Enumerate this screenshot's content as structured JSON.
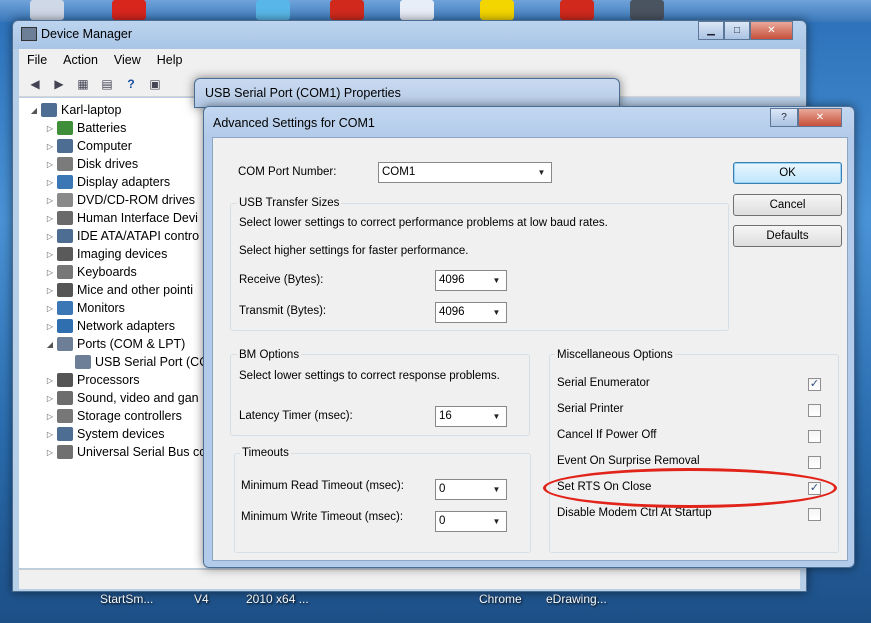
{
  "taskbar": {
    "labels": [
      "StartSm...",
      "V4",
      "2010 x64 ...",
      "Chrome",
      "eDrawing..."
    ]
  },
  "device_manager": {
    "title": "Device Manager",
    "menu": [
      "File",
      "Action",
      "View",
      "Help"
    ],
    "tree": {
      "root": "Karl-laptop",
      "items": [
        {
          "label": "Batteries",
          "icon": "battery-icon"
        },
        {
          "label": "Computer",
          "icon": "computer-icon"
        },
        {
          "label": "Disk drives",
          "icon": "disk-drive-icon"
        },
        {
          "label": "Display adapters",
          "icon": "display-adapter-icon"
        },
        {
          "label": "DVD/CD-ROM drives",
          "icon": "dvd-drive-icon"
        },
        {
          "label": "Human Interface Devi",
          "icon": "hid-icon"
        },
        {
          "label": "IDE ATA/ATAPI contro",
          "icon": "ide-controller-icon"
        },
        {
          "label": "Imaging devices",
          "icon": "camera-icon"
        },
        {
          "label": "Keyboards",
          "icon": "keyboard-icon"
        },
        {
          "label": "Mice and other pointi",
          "icon": "mouse-icon"
        },
        {
          "label": "Monitors",
          "icon": "monitor-icon"
        },
        {
          "label": "Network adapters",
          "icon": "network-adapter-icon"
        },
        {
          "label": "Ports (COM & LPT)",
          "icon": "port-icon"
        },
        {
          "label": "USB Serial Port (CO",
          "icon": "port-icon"
        },
        {
          "label": "Processors",
          "icon": "processor-icon"
        },
        {
          "label": "Sound, video and gan",
          "icon": "sound-icon"
        },
        {
          "label": "Storage controllers",
          "icon": "storage-controller-icon"
        },
        {
          "label": "System devices",
          "icon": "system-device-icon"
        },
        {
          "label": "Universal Serial Bus co",
          "icon": "usb-icon"
        }
      ]
    }
  },
  "properties_window": {
    "title": "USB Serial Port (COM1) Properties"
  },
  "advanced": {
    "title": "Advanced Settings for COM1",
    "com_port_label": "COM Port Number:",
    "com_port_value": "COM1",
    "usb_transfer": {
      "title": "USB Transfer Sizes",
      "line1": "Select lower settings to correct performance problems at low baud rates.",
      "line2": "Select higher settings for faster performance.",
      "receive_label": "Receive (Bytes):",
      "receive_value": "4096",
      "transmit_label": "Transmit (Bytes):",
      "transmit_value": "4096"
    },
    "bm_options": {
      "title": "BM Options",
      "line": "Select lower settings to correct response problems.",
      "latency_label": "Latency Timer (msec):",
      "latency_value": "16"
    },
    "timeouts": {
      "title": "Timeouts",
      "read_label": "Minimum Read Timeout (msec):",
      "read_value": "0",
      "write_label": "Minimum Write Timeout (msec):",
      "write_value": "0"
    },
    "misc": {
      "title": "Miscellaneous Options",
      "options": [
        {
          "label": "Serial Enumerator",
          "checked": true
        },
        {
          "label": "Serial Printer",
          "checked": false
        },
        {
          "label": "Cancel If Power Off",
          "checked": false
        },
        {
          "label": "Event On Surprise Removal",
          "checked": false
        },
        {
          "label": "Set RTS On Close",
          "checked": true
        },
        {
          "label": "Disable Modem Ctrl At Startup",
          "checked": false
        }
      ]
    },
    "buttons": {
      "ok": "OK",
      "cancel": "Cancel",
      "defaults": "Defaults"
    },
    "help_glyph": "?",
    "close_glyph": "✕"
  },
  "colors": {
    "annotation": "#e2231a",
    "check": "#2d4e7e"
  }
}
